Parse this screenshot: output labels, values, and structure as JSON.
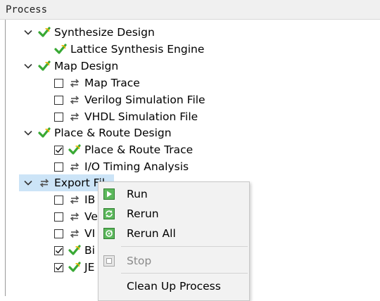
{
  "panel": {
    "title": "Process"
  },
  "colors": {
    "selection": "#cce4f7",
    "check_green": "#3aaa2e",
    "refresh_gray": "#555555"
  },
  "tree": [
    {
      "label": "Synthesize Design",
      "icon": "green-check-icon",
      "expandable": true
    },
    {
      "label": "Lattice Synthesis Engine",
      "icon": "green-check-icon"
    },
    {
      "label": "Map Design",
      "icon": "green-check-icon",
      "expandable": true
    },
    {
      "label": "Map Trace",
      "icon": "refresh-icon",
      "checked": false
    },
    {
      "label": "Verilog Simulation File",
      "icon": "refresh-icon",
      "checked": false
    },
    {
      "label": "VHDL Simulation File",
      "icon": "refresh-icon",
      "checked": false
    },
    {
      "label": "Place & Route Design",
      "icon": "green-check-icon",
      "expandable": true
    },
    {
      "label": "Place & Route Trace",
      "icon": "green-check-icon",
      "checked": true
    },
    {
      "label": "I/O Timing Analysis",
      "icon": "refresh-icon",
      "checked": false
    },
    {
      "label": "Export Fil",
      "icon": "refresh-icon",
      "expandable": true,
      "selected": true
    },
    {
      "label": "IB",
      "icon": "refresh-icon",
      "checked": false
    },
    {
      "label": "Ve",
      "icon": "refresh-icon",
      "checked": false
    },
    {
      "label": "VI",
      "icon": "refresh-icon",
      "checked": false
    },
    {
      "label": "Bi",
      "icon": "green-check-icon",
      "checked": true
    },
    {
      "label": "JE",
      "icon": "green-check-icon",
      "checked": true
    }
  ],
  "context_menu": {
    "items": [
      {
        "label": "Run",
        "icon": "run-icon",
        "enabled": true
      },
      {
        "label": "Rerun",
        "icon": "rerun-icon",
        "enabled": true
      },
      {
        "label": "Rerun All",
        "icon": "rerun-all-icon",
        "enabled": true
      },
      {
        "label": "Stop",
        "icon": "stop-icon",
        "enabled": false
      },
      {
        "label": "Clean Up Process",
        "icon": "",
        "enabled": true
      }
    ]
  }
}
